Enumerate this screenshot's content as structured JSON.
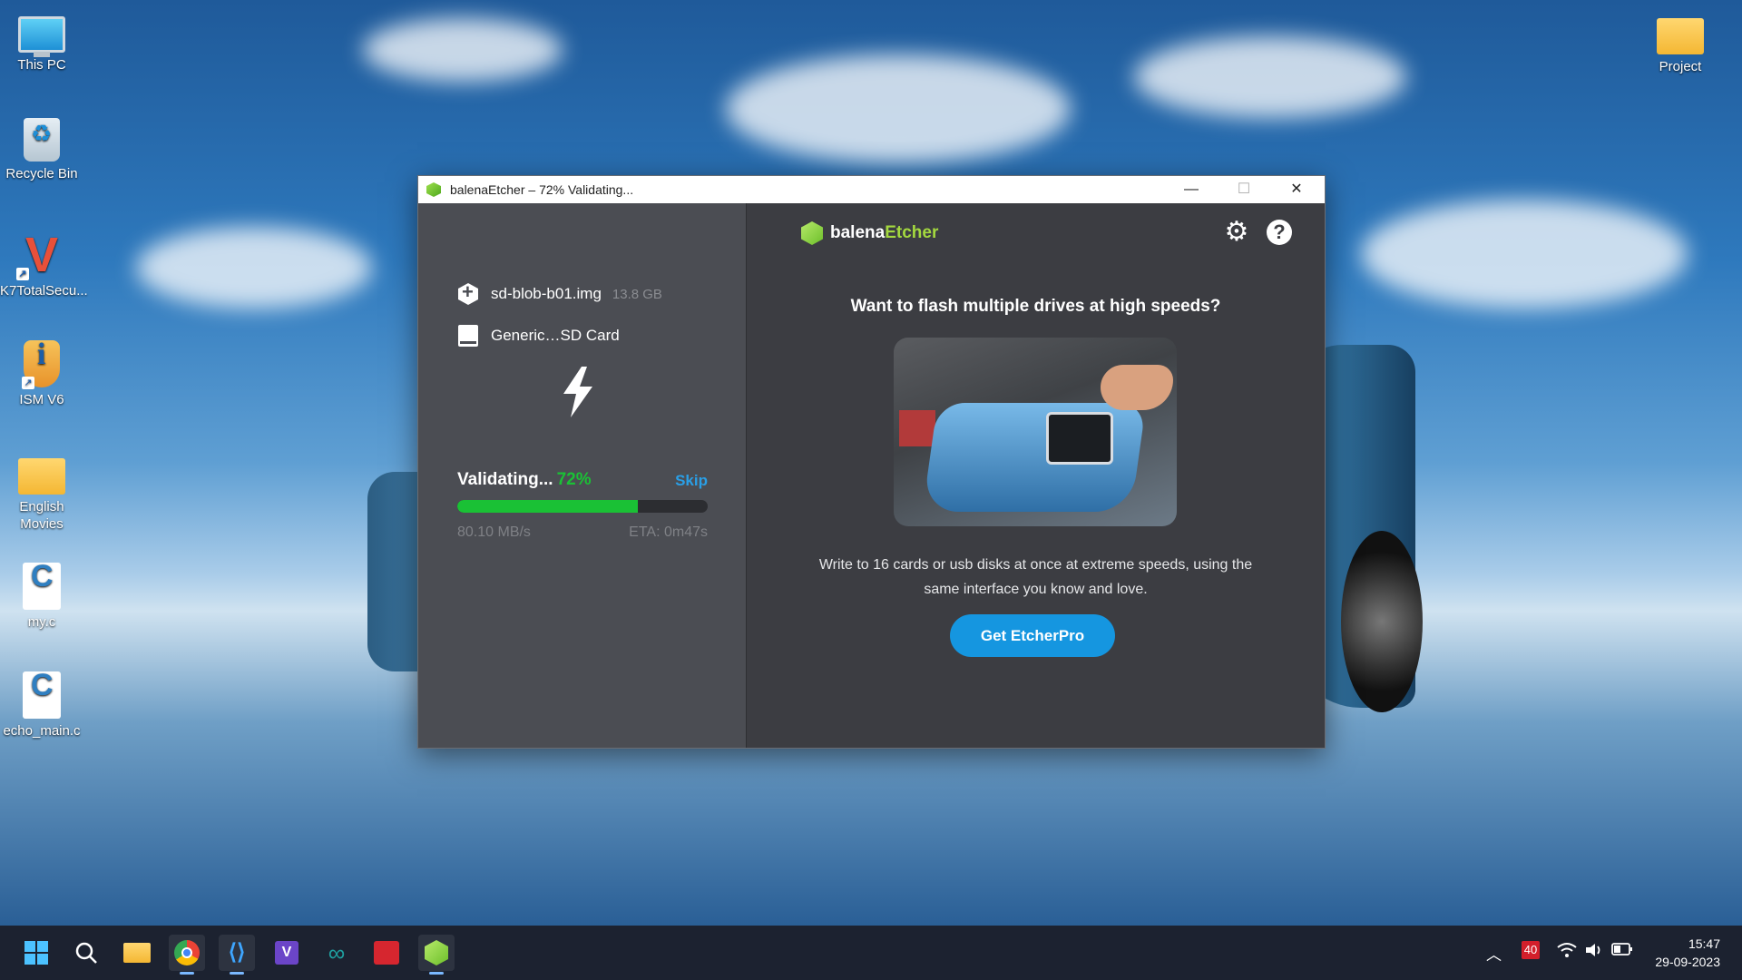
{
  "desktop": {
    "icons": [
      {
        "label": "This PC"
      },
      {
        "label": "Recycle Bin"
      },
      {
        "label": "K7TotalSecu..."
      },
      {
        "label": "ISM V6"
      },
      {
        "label": "English Movies"
      },
      {
        "label": "my.c"
      },
      {
        "label": "echo_main.c"
      },
      {
        "label": "Project"
      }
    ]
  },
  "window": {
    "title": "balenaEtcher – 72% Validating...",
    "controls": {
      "minimize": "—",
      "maximize": "☐",
      "close": "✕"
    }
  },
  "etcher": {
    "image": {
      "name": "sd-blob-b01.img",
      "size": "13.8 GB"
    },
    "target": {
      "name": "Generic…SD Card"
    },
    "status": {
      "label": "Validating...",
      "percent_text": "72%",
      "progress": 0.72,
      "skip_label": "Skip",
      "speed": "80.10 MB/s",
      "eta": "ETA: 0m47s"
    },
    "brand": {
      "part1": "balena",
      "part2": "Etcher"
    },
    "icons": {
      "settings": "gear-icon",
      "help": "help-icon",
      "help_glyph": "?"
    },
    "promo": {
      "title": "Want to flash multiple drives at high speeds?",
      "text": "Write to 16 cards or usb disks at once at extreme speeds, using the same interface you know and love.",
      "cta": "Get EtcherPro"
    },
    "colors": {
      "accent_green": "#1ac135",
      "link_blue": "#2a9fe6",
      "cta_blue": "#1596e0",
      "brand_green": "#a4d93f"
    }
  },
  "taskbar": {
    "badge": "40",
    "time": "15:47",
    "date": "29-09-2023"
  }
}
